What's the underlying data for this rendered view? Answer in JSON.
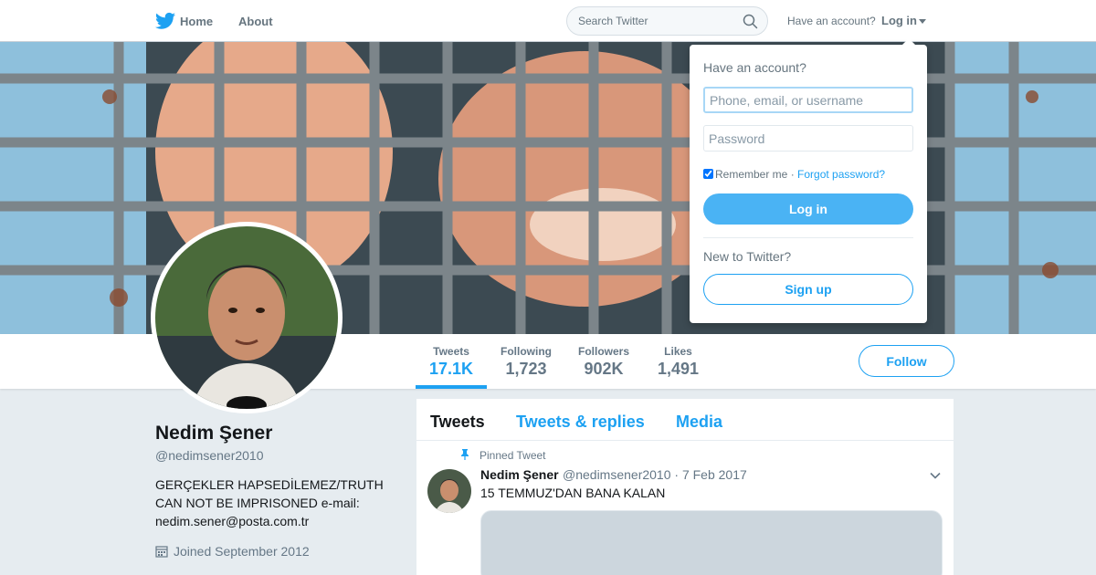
{
  "nav": {
    "home_label": "Home",
    "about_label": "About",
    "search_placeholder": "Search Twitter",
    "have_account": "Have an account?",
    "login_label": "Log in"
  },
  "profile": {
    "name": "Nedim Şener",
    "handle": "@nedimsener2010",
    "bio": "GERÇEKLER HAPSEDİLEMEZ/TRUTH CAN NOT BE IMPRISONED e-mail: nedim.sener@posta.com.tr",
    "joined": "Joined September 2012",
    "follow_label": "Follow"
  },
  "stats": [
    {
      "label": "Tweets",
      "value": "17.1K",
      "active": true
    },
    {
      "label": "Following",
      "value": "1,723"
    },
    {
      "label": "Followers",
      "value": "902K"
    },
    {
      "label": "Likes",
      "value": "1,491"
    }
  ],
  "timeline": {
    "tabs": [
      {
        "label": "Tweets",
        "active": true
      },
      {
        "label": "Tweets & replies"
      },
      {
        "label": "Media"
      }
    ],
    "pinned": {
      "label": "Pinned Tweet",
      "author": "Nedim Şener",
      "handle_date": "@nedimsener2010 · 7 Feb 2017",
      "text": "15 TEMMUZ'DAN BANA KALAN"
    }
  },
  "login_dropdown": {
    "title": "Have an account?",
    "username_placeholder": "Phone, email, or username",
    "password_placeholder": "Password",
    "remember_label": "Remember me",
    "separator": " · ",
    "forgot_label": "Forgot password?",
    "remember_checked": true,
    "login_button": "Log in",
    "new_label": "New to Twitter?",
    "signup_button": "Sign up"
  },
  "colors": {
    "accent": "#1da1f2",
    "button_blue": "#4ab3f4",
    "background": "#e6ecf0"
  },
  "icons": [
    "twitter-bird-icon",
    "search-icon",
    "caret-down-icon",
    "calendar-icon",
    "pin-icon",
    "chevron-down-icon"
  ]
}
